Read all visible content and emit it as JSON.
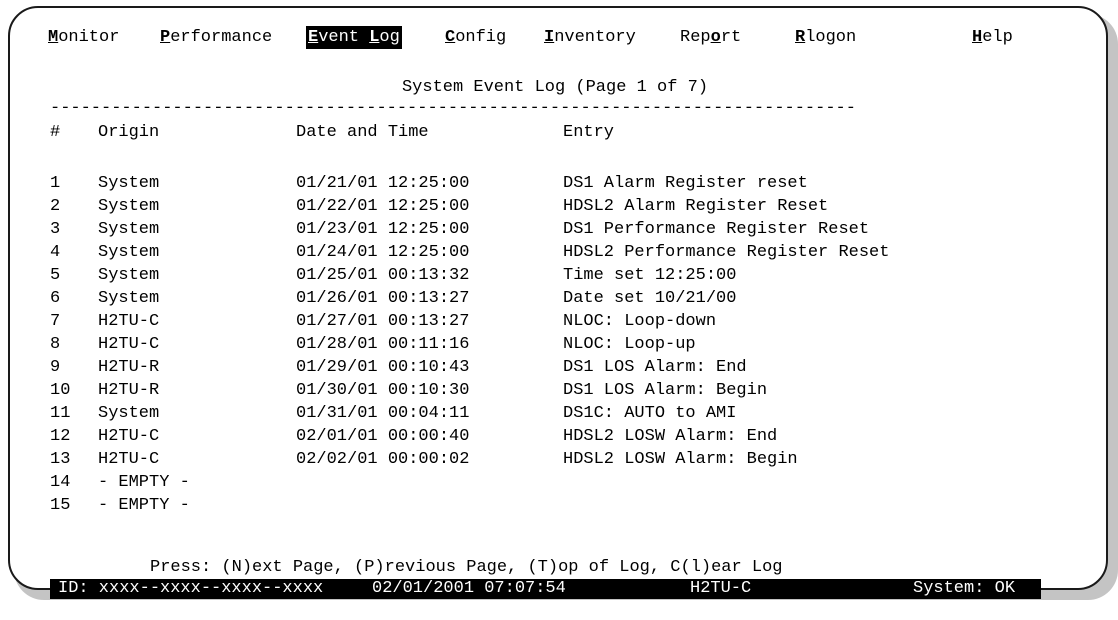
{
  "menu": {
    "items": [
      {
        "hot": "M",
        "rest": "onitor",
        "active": false
      },
      {
        "hot": "P",
        "rest": "erformance",
        "active": false
      },
      {
        "hot": "E",
        "rest": "vent ",
        "hot2": "L",
        "rest2": "og",
        "active": true
      },
      {
        "hot": "C",
        "rest": "onfig",
        "active": false
      },
      {
        "hot": "I",
        "rest": "nventory",
        "active": false
      },
      {
        "pre": "Rep",
        "hot": "o",
        "rest": "rt",
        "active": false
      },
      {
        "hot": "R",
        "rest": "logon",
        "active": false
      },
      {
        "hot": "H",
        "rest": "elp",
        "active": false
      }
    ]
  },
  "page_title": "System Event Log (Page 1 of 7)",
  "rule": "-------------------------------------------------------------------------------",
  "columns": {
    "num": "#",
    "origin": "Origin",
    "date": "Date and Time",
    "entry": "Entry"
  },
  "rows": [
    {
      "num": "1",
      "origin": "System",
      "date": "01/21/01 12:25:00",
      "entry": "DS1 Alarm Register reset"
    },
    {
      "num": "2",
      "origin": "System",
      "date": "01/22/01 12:25:00",
      "entry": "HDSL2 Alarm Register Reset"
    },
    {
      "num": "3",
      "origin": "System",
      "date": "01/23/01 12:25:00",
      "entry": "DS1 Performance Register Reset"
    },
    {
      "num": "4",
      "origin": "System",
      "date": "01/24/01 12:25:00",
      "entry": "HDSL2 Performance Register Reset"
    },
    {
      "num": "5",
      "origin": "System",
      "date": "01/25/01 00:13:32",
      "entry": "Time set 12:25:00"
    },
    {
      "num": "6",
      "origin": "System",
      "date": "01/26/01 00:13:27",
      "entry": "Date set 10/21/00"
    },
    {
      "num": "7",
      "origin": "H2TU-C",
      "date": "01/27/01 00:13:27",
      "entry": "NLOC: Loop-down"
    },
    {
      "num": "8",
      "origin": "H2TU-C",
      "date": "01/28/01 00:11:16",
      "entry": "NLOC: Loop-up"
    },
    {
      "num": "9",
      "origin": "H2TU-R",
      "date": "01/29/01 00:10:43",
      "entry": "DS1 LOS Alarm: End"
    },
    {
      "num": "10",
      "origin": "H2TU-R",
      "date": "01/30/01 00:10:30",
      "entry": "DS1 LOS Alarm: Begin"
    },
    {
      "num": "11",
      "origin": "System",
      "date": "01/31/01 00:04:11",
      "entry": "DS1C: AUTO to AMI"
    },
    {
      "num": "12",
      "origin": "H2TU-C",
      "date": "02/01/01 00:00:40",
      "entry": "HDSL2 LOSW Alarm: End"
    },
    {
      "num": "13",
      "origin": "H2TU-C",
      "date": "02/02/01 00:00:02",
      "entry": "HDSL2 LOSW Alarm: Begin"
    },
    {
      "num": "14",
      "origin": "- EMPTY -",
      "date": "",
      "entry": ""
    },
    {
      "num": "15",
      "origin": "- EMPTY -",
      "date": "",
      "entry": ""
    }
  ],
  "prompt": "Press: (N)ext Page, (P)revious Page, (T)op of Log, C(l)ear Log",
  "status_bar": {
    "id": "ID: xxxx--xxxx--xxxx--xxxx",
    "datetime": "02/01/2001 07:07:54",
    "unit": "H2TU-C",
    "system": "System: OK"
  }
}
